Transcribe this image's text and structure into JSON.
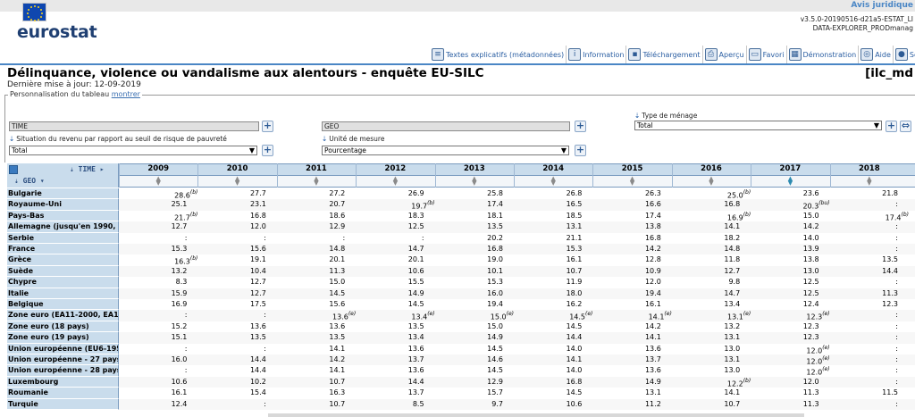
{
  "header": {
    "legal_link": "Avis juridique",
    "logo": "eurostat",
    "version_line1": "v3.5.0-20190516-d21a5-ESTAT_LI",
    "version_line2": "DATA-EXPLORER_PRODmanag"
  },
  "toolbar": {
    "items": [
      {
        "label": "Textes explicatifs (métadonnées)",
        "icon": "document-icon"
      },
      {
        "label": "Information",
        "icon": "info-icon"
      },
      {
        "label": "Téléchargement",
        "icon": "download-icon"
      },
      {
        "label": "Aperçu",
        "icon": "print-icon"
      },
      {
        "label": "Favori",
        "icon": "folder-icon"
      },
      {
        "label": "Démonstration",
        "icon": "film-icon"
      },
      {
        "label": "Aide",
        "icon": "help-icon"
      },
      {
        "label": "Se",
        "icon": "user-icon"
      }
    ]
  },
  "page": {
    "title": "Délinquance, violence ou vandalisme aux alentours - enquête EU-SILC",
    "code": "[ilc_md",
    "updated": "Dernière mise à jour: 12-09-2019"
  },
  "customize": {
    "legend": "Personnalisation du tableau",
    "show_link": "montrer",
    "time_field": "TIME",
    "geo_field": "GEO",
    "household_label": "Type de ménage",
    "household_value": "Total",
    "income_label": "Situation du revenu par rapport au seuil de risque de pauvreté",
    "income_value": "Total",
    "unit_label": "Unité de mesure",
    "unit_value": "Pourcentage"
  },
  "table": {
    "time_header": "TIME",
    "geo_header": "GEO",
    "years": [
      "2009",
      "2010",
      "2011",
      "2012",
      "2013",
      "2014",
      "2015",
      "2016",
      "2017",
      "2018"
    ],
    "rows": [
      {
        "geo": "Bulgarie",
        "v": [
          "28.6|b",
          "27.7",
          "27.2",
          "26.9",
          "25.8",
          "26.8",
          "26.3",
          "25.0|b",
          "23.6",
          "21.8"
        ]
      },
      {
        "geo": "Royaume-Uni",
        "v": [
          "25.1",
          "23.1",
          "20.7",
          "19.7|b",
          "17.4",
          "16.5",
          "16.6",
          "16.8",
          "20.3|bu",
          ":"
        ]
      },
      {
        "geo": "Pays-Bas",
        "v": [
          "21.7|b",
          "16.8",
          "18.6",
          "18.3",
          "18.1",
          "18.5",
          "17.4",
          "16.9|b",
          "15.0",
          "17.4|b"
        ]
      },
      {
        "geo": "Allemagne (jusqu'en 1990, ar",
        "v": [
          "12.7",
          "12.0",
          "12.9",
          "12.5",
          "13.5",
          "13.1",
          "13.8",
          "14.1",
          "14.2",
          ":"
        ]
      },
      {
        "geo": "Serbie",
        "v": [
          ":",
          ":",
          ":",
          ":",
          "20.2",
          "21.1",
          "16.8",
          "18.2",
          "14.0",
          ":"
        ]
      },
      {
        "geo": "France",
        "v": [
          "15.3",
          "15.6",
          "14.8",
          "14.7",
          "16.8",
          "15.3",
          "14.2",
          "14.8",
          "13.9",
          ":"
        ]
      },
      {
        "geo": "Grèce",
        "v": [
          "16.3|b",
          "19.1",
          "20.1",
          "20.1",
          "19.0",
          "16.1",
          "12.8",
          "11.8",
          "13.8",
          "13.5"
        ]
      },
      {
        "geo": "Suède",
        "v": [
          "13.2",
          "10.4",
          "11.3",
          "10.6",
          "10.1",
          "10.7",
          "10.9",
          "12.7",
          "13.0",
          "14.4"
        ]
      },
      {
        "geo": "Chypre",
        "v": [
          "8.3",
          "12.7",
          "15.0",
          "15.5",
          "15.3",
          "11.9",
          "12.0",
          "9.8",
          "12.5",
          ":"
        ]
      },
      {
        "geo": "Italie",
        "v": [
          "15.9",
          "12.7",
          "14.5",
          "14.9",
          "16.0",
          "18.0",
          "19.4",
          "14.7",
          "12.5",
          "11.3"
        ]
      },
      {
        "geo": "Belgique",
        "v": [
          "16.9",
          "17.5",
          "15.6",
          "14.5",
          "19.4",
          "16.2",
          "16.1",
          "13.4",
          "12.4",
          "12.3"
        ]
      },
      {
        "geo": "Zone euro (EA11-2000, EA12",
        "v": [
          ":",
          ":",
          "13.6|e",
          "13.4|e",
          "15.0|e",
          "14.5|e",
          "14.1|e",
          "13.1|e",
          "12.3|e",
          ":"
        ]
      },
      {
        "geo": "Zone euro (18 pays)",
        "v": [
          "15.2",
          "13.6",
          "13.6",
          "13.5",
          "15.0",
          "14.5",
          "14.2",
          "13.2",
          "12.3",
          ":"
        ]
      },
      {
        "geo": "Zone euro (19 pays)",
        "v": [
          "15.1",
          "13.5",
          "13.5",
          "13.4",
          "14.9",
          "14.4",
          "14.1",
          "13.1",
          "12.3",
          ":"
        ]
      },
      {
        "geo": "Union européenne (EU6-1958",
        "v": [
          ":",
          ":",
          "14.1",
          "13.6",
          "14.5",
          "14.0",
          "13.6",
          "13.0",
          "12.0|e",
          ":"
        ]
      },
      {
        "geo": "Union européenne - 27 pays (",
        "v": [
          "16.0",
          "14.4",
          "14.2",
          "13.7",
          "14.6",
          "14.1",
          "13.7",
          "13.1",
          "12.0|e",
          ":"
        ]
      },
      {
        "geo": "Union européenne - 28 pays",
        "v": [
          ":",
          "14.4",
          "14.1",
          "13.6",
          "14.5",
          "14.0",
          "13.6",
          "13.0",
          "12.0|e",
          ":"
        ]
      },
      {
        "geo": "Luxembourg",
        "v": [
          "10.6",
          "10.2",
          "10.7",
          "14.4",
          "12.9",
          "16.8",
          "14.9",
          "12.2|b",
          "12.0",
          ":"
        ]
      },
      {
        "geo": "Roumanie",
        "v": [
          "16.1",
          "15.4",
          "16.3",
          "13.7",
          "15.7",
          "14.5",
          "13.1",
          "14.1",
          "11.3",
          "11.5"
        ]
      },
      {
        "geo": "Turquie",
        "v": [
          "12.4",
          ":",
          "10.7",
          "8.5",
          "9.7",
          "10.6",
          "11.2",
          "10.7",
          "11.3",
          ":"
        ]
      }
    ]
  }
}
